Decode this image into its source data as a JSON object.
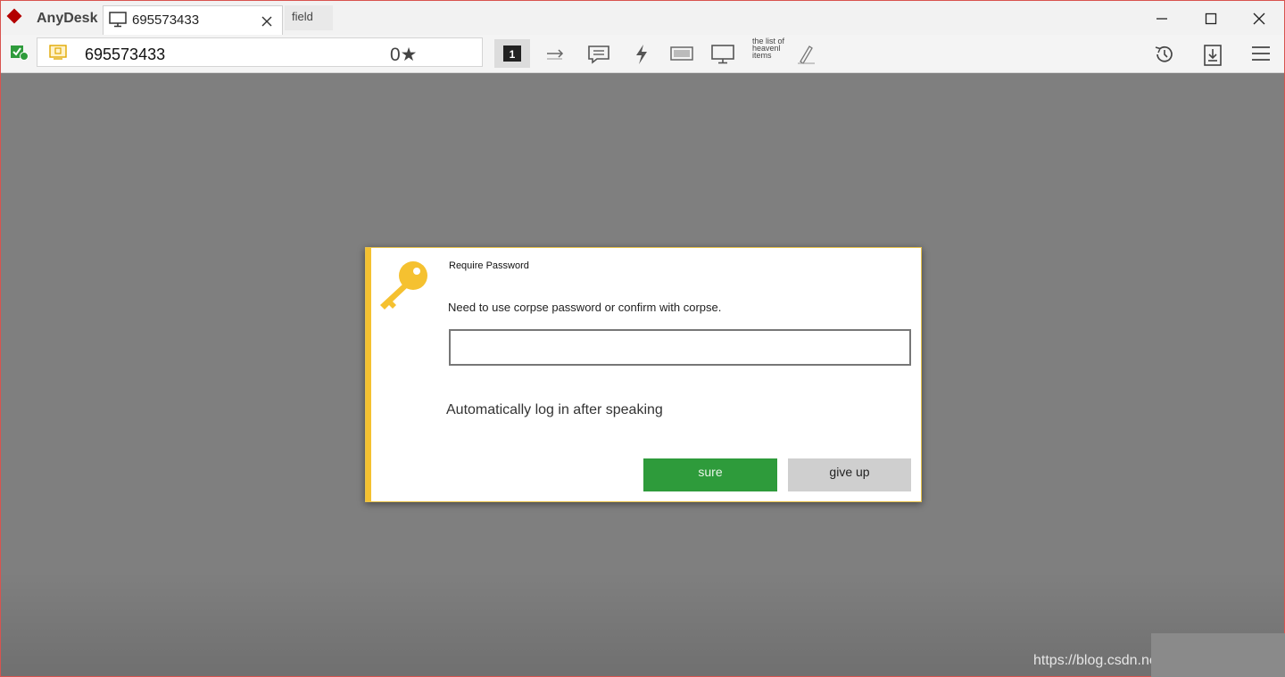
{
  "app": {
    "name": "AnyDesk"
  },
  "tab": {
    "label": "695573433"
  },
  "field_button": {
    "label": "field"
  },
  "address_bar": {
    "value": "695573433",
    "rating": "0★"
  },
  "toolbar": {
    "screen_number": "1",
    "tiny_text": "the list of heavenl items"
  },
  "dialog": {
    "title": "Require Password",
    "message": "Need to use corpse password or confirm with corpse.",
    "password_value": "",
    "auto_login_label": "Automatically log in after speaking",
    "sure_label": "sure",
    "give_up_label": "give up"
  },
  "watermark": {
    "text": "https://blog.csdn.ne"
  },
  "colors": {
    "accent": "#f5c130",
    "confirm": "#2e9b3b",
    "brand": "#b30000"
  }
}
